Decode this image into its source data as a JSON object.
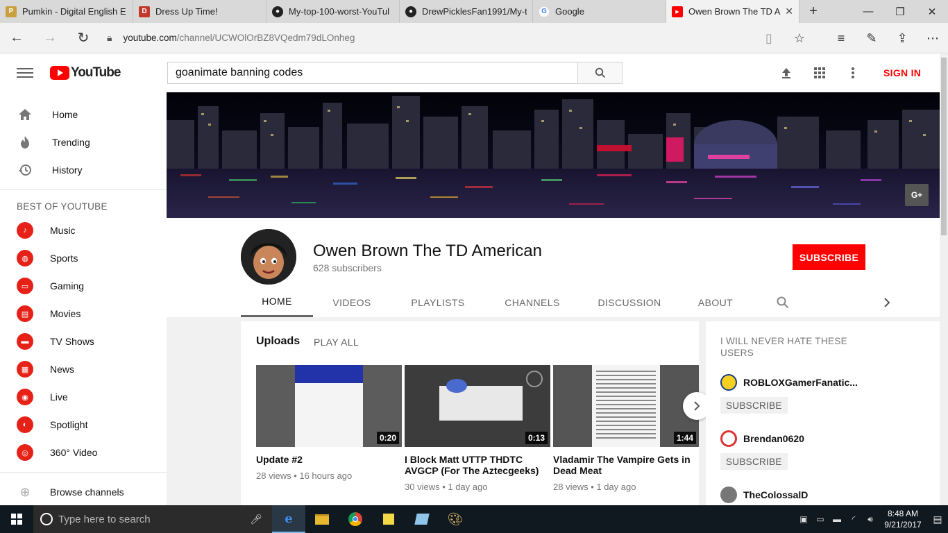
{
  "browser": {
    "tabs": [
      {
        "title": "Pumkin - Digital English E",
        "fav_color": "#c8a040",
        "fav_glyph": "P"
      },
      {
        "title": "Dress Up Time!",
        "fav_color": "#c0392b",
        "fav_glyph": "D"
      },
      {
        "title": "My-top-100-worst-YouTul",
        "fav_color": "#222222",
        "fav_glyph": "G"
      },
      {
        "title": "DrewPicklesFan1991/My-t",
        "fav_color": "#222222",
        "fav_glyph": "G"
      },
      {
        "title": "Google",
        "fav_color": "#4285f4",
        "fav_glyph": "G"
      },
      {
        "title": "Owen Brown The TD A",
        "fav_color": "#ff0000",
        "fav_glyph": "▶"
      }
    ],
    "url_domain": "youtube.com",
    "url_path": "/channel/UCWOlOrBZ8VQedm79dLOnheg"
  },
  "youtube": {
    "logo_text": "YouTube",
    "search_value": "goanimate banning codes",
    "signin_label": "SIGN IN"
  },
  "sidebar": {
    "main_items": [
      {
        "label": "Home",
        "icon": "home-icon"
      },
      {
        "label": "Trending",
        "icon": "fire-icon"
      },
      {
        "label": "History",
        "icon": "history-icon"
      }
    ],
    "section_title": "BEST OF YOUTUBE",
    "categories": [
      {
        "label": "Music",
        "icon": "music-icon"
      },
      {
        "label": "Sports",
        "icon": "sports-icon"
      },
      {
        "label": "Gaming",
        "icon": "gaming-icon"
      },
      {
        "label": "Movies",
        "icon": "movies-icon"
      },
      {
        "label": "TV Shows",
        "icon": "tv-icon"
      },
      {
        "label": "News",
        "icon": "news-icon"
      },
      {
        "label": "Live",
        "icon": "live-icon"
      },
      {
        "label": "Spotlight",
        "icon": "spotlight-icon"
      },
      {
        "label": "360° Video",
        "icon": "360-icon"
      }
    ],
    "browse_label": "Browse channels"
  },
  "channel": {
    "name": "Owen Brown The TD American",
    "subscribers": "628 subscribers",
    "subscribe_label": "SUBSCRIBE",
    "tabs": [
      "HOME",
      "VIDEOS",
      "PLAYLISTS",
      "CHANNELS",
      "DISCUSSION",
      "ABOUT"
    ],
    "active_tab": "HOME"
  },
  "uploads": {
    "title": "Uploads",
    "play_all": "PLAY ALL",
    "videos": [
      {
        "title": "Update #2",
        "meta": "28 views • 16 hours ago",
        "duration": "0:20"
      },
      {
        "title": "I Block Matt UTTP THDTC AVGCP (For The Aztecgeeks)",
        "meta": "30 views • 1 day ago",
        "duration": "0:13"
      },
      {
        "title": "Vladamir The Vampire Gets in Dead Meat",
        "meta": "28 views • 1 day ago",
        "duration": "1:44"
      }
    ]
  },
  "featured": {
    "title": "I WILL NEVER HATE THESE USERS",
    "channels": [
      {
        "name": "ROBLOXGamerFanatic...",
        "subscribe": "SUBSCRIBE",
        "color": "#f5d020"
      },
      {
        "name": "Brendan0620",
        "subscribe": "SUBSCRIBE",
        "color": "#d33"
      },
      {
        "name": "TheColossalD",
        "subscribe": "",
        "color": "#777"
      }
    ]
  },
  "taskbar": {
    "search_placeholder": "Type here to search",
    "time": "8:48 AM",
    "date": "9/21/2017"
  },
  "colors": {
    "accent": "#ff0000",
    "taskbar": "#101820"
  }
}
